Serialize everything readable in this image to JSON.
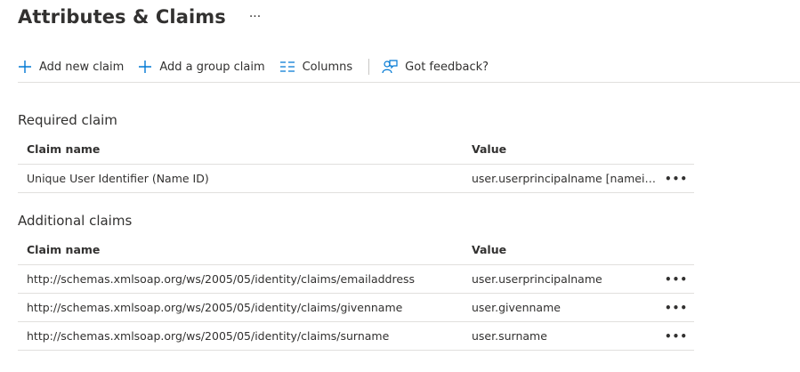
{
  "header": {
    "title": "Attributes & Claims",
    "more": "···"
  },
  "toolbar": {
    "add_new_claim": "Add new claim",
    "add_group_claim": "Add a group claim",
    "columns": "Columns",
    "feedback": "Got feedback?"
  },
  "required": {
    "section_title": "Required claim",
    "col_name": "Claim name",
    "col_value": "Value",
    "rows": [
      {
        "name": "Unique User Identifier (Name ID)",
        "value": "user.userprincipalname [nameid-format:emailAddress]",
        "more": "•••"
      }
    ]
  },
  "additional": {
    "section_title": "Additional claims",
    "col_name": "Claim name",
    "col_value": "Value",
    "rows": [
      {
        "name": "http://schemas.xmlsoap.org/ws/2005/05/identity/claims/emailaddress",
        "value": "user.userprincipalname",
        "more": "•••"
      },
      {
        "name": "http://schemas.xmlsoap.org/ws/2005/05/identity/claims/givenname",
        "value": "user.givenname",
        "more": "•••"
      },
      {
        "name": "http://schemas.xmlsoap.org/ws/2005/05/identity/claims/surname",
        "value": "user.surname",
        "more": "•••"
      }
    ]
  },
  "colors": {
    "accent": "#0078d4",
    "border": "#e1dfdd",
    "text": "#323130"
  }
}
